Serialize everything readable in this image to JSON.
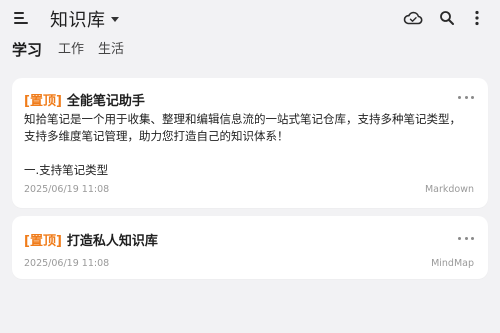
{
  "header": {
    "title": "知识库",
    "icons": [
      "menu-icon",
      "cloud-icon",
      "search-icon",
      "more-vertical-icon"
    ]
  },
  "tabs": [
    {
      "label": "学习",
      "active": true
    },
    {
      "label": "工作",
      "active": false
    },
    {
      "label": "生活",
      "active": false
    }
  ],
  "notes": [
    {
      "pin_label": "[置顶]",
      "title": "全能笔记助手",
      "body_line1": "知拾笔记是一个用于收集、整理和编辑信息流的一站式笔记仓库，支持多种笔记类型，",
      "body_line2": "支持多维度笔记管理，助力您打造自己的知识体系！",
      "body_line3": "一.支持笔记类型",
      "date": "2025/06/19 11:08",
      "type": "Markdown"
    },
    {
      "pin_label": "[置顶]",
      "title": "打造私人知识库",
      "date": "2025/06/19 11:08",
      "type": "MindMap"
    }
  ],
  "colors": {
    "pin": "#f07c1a",
    "background": "#f2f2f4",
    "card": "#ffffff"
  }
}
